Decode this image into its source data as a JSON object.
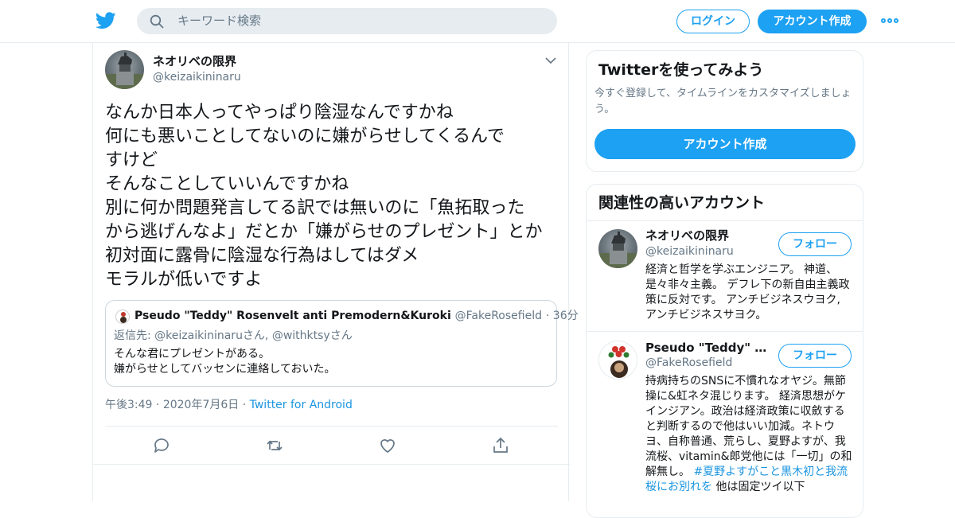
{
  "header": {
    "search_placeholder": "キーワード検索",
    "login_label": "ログイン",
    "signup_label": "アカウント作成",
    "accent_color": "#1da1f2"
  },
  "tweet": {
    "author_name": "ネオリベの限界",
    "author_handle": "@keizaikininaru",
    "text": "なんか日本人ってやっぱり陰湿なんですかね\n何にも悪いことしてないのに嫌がらせしてくるんで\nすけど\nそんなことしていいんですかね\n別に何か問題発言してる訳では無いのに「魚拓取った\nから逃げんなよ」だとか「嫌がらせのプレゼント」とか\n初対面に露骨に陰湿な行為はしてはダメ\nモラルが低いですよ",
    "quoted": {
      "author_name": "Pseudo \"Teddy\" Rosenvelt anti Premodern&Kuroki",
      "author_handle": "@FakeRosefield",
      "time_ago": "36分",
      "reply_to": "返信先: @keizaikininaruさん, @withktsyさん",
      "text": "そんな君にプレゼントがある。\n嫌がらせとしてバッセンに連絡しておいた。"
    },
    "time": "午後3:49",
    "date": "2020年7月6日",
    "source": "Twitter for Android"
  },
  "signup_card": {
    "title": "Twitterを使ってみよう",
    "subtitle": "今すぐ登録して、タイムラインをカスタマイズしましょう。",
    "button_label": "アカウント作成"
  },
  "related": {
    "title": "関連性の高いアカウント",
    "accounts": [
      {
        "name": "ネオリベの限界",
        "handle": "@keizaikininaru",
        "follow_label": "フォロー",
        "bio": "経済と哲学を学ぶエンジニア。 神道、是々非々主義。 デフレ下の新自由主義政策に反対です。 アンチビジネスウヨク, アンチビジネスサヨク。"
      },
      {
        "name": "Pseudo \"Teddy\" Rose...",
        "handle": "@FakeRosefield",
        "follow_label": "フォロー",
        "bio_pre": "持病持ちのSNSに不慣れなオヤジ。無節操に&虹ネタ混じります。 経済思想がケインジアン。政治は経済政策に収斂すると判断するので他はいい加減。ネトウヨ、自称普通、荒らし、夏野よすが、我流桜、vitamin&郎党他には「一切」の和解無し。 ",
        "bio_tag": "#夏野よすがこと黒木初と我流桜にお別れを",
        "bio_post": " 他は固定ツイ以下"
      }
    ]
  }
}
